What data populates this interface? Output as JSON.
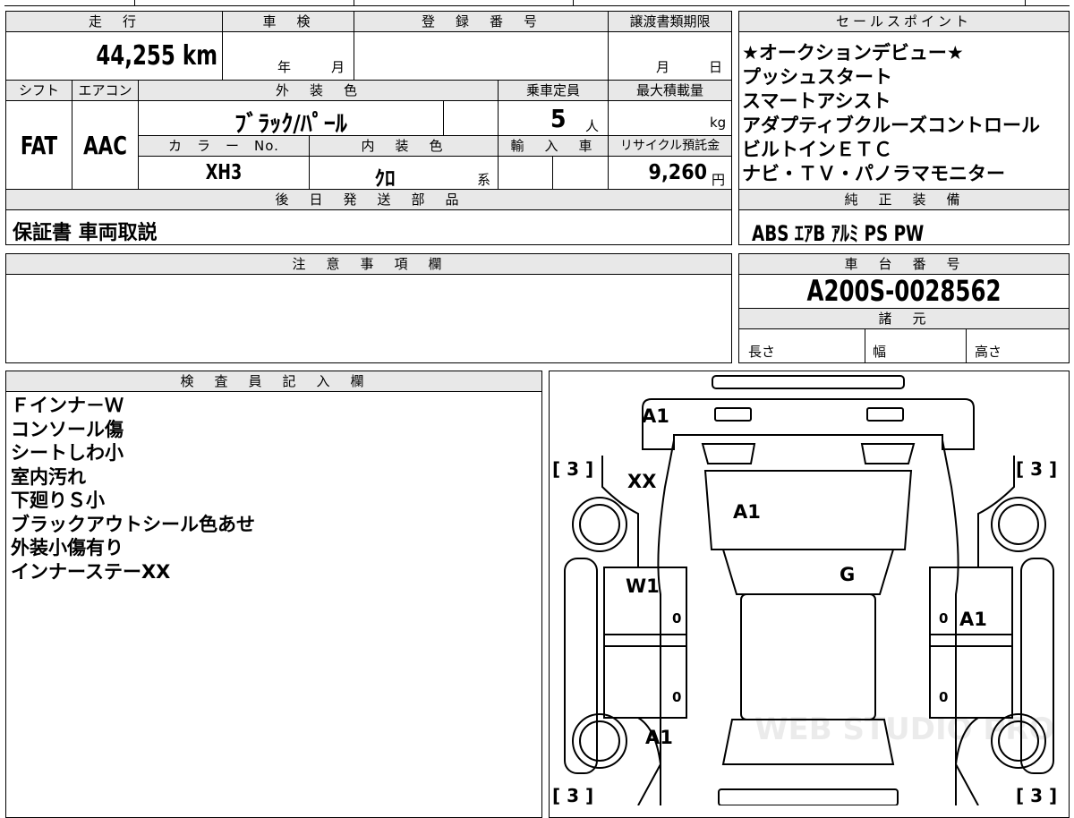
{
  "top_table": {
    "mileage_header": "走　行",
    "mileage_value": "44,255 km",
    "inspection_header": "車　検",
    "inspection_year_label": "年",
    "inspection_month_label": "月",
    "registration_header": "登　録　番　号",
    "transfer_deadline_header": "譲渡書類期限",
    "transfer_month_label": "月",
    "transfer_day_label": "日",
    "shift_header": "シフト",
    "shift_value": "FAT",
    "ac_header": "エアコン",
    "ac_value": "AAC",
    "exterior_color_header": "外　装　色",
    "exterior_color_value": "ﾌﾞﾗｯｸ/ﾊﾟｰﾙ",
    "capacity_header": "乗車定員",
    "capacity_value": "5",
    "capacity_unit": "人",
    "max_load_header": "最大積載量",
    "max_load_unit": "kg",
    "color_no_header": "カ　ラ　ー　No.",
    "color_no_value": "XH3",
    "interior_color_header": "内　装　色",
    "interior_color_value": "ｸﾛ",
    "interior_color_suffix": "系",
    "import_header": "輸　入　車",
    "recycle_header": "リサイクル預託金",
    "recycle_value": "9,260",
    "recycle_unit": "円"
  },
  "sales_points": {
    "header": "セールスポイント",
    "lines": [
      "★オークションデビュー★",
      "プッシュスタート",
      "スマートアシスト",
      "アダプティブクルーズコントロール",
      "ビルトインＥＴＣ",
      "ナビ・ＴＶ・パノラマモニター"
    ]
  },
  "later_parts": {
    "header": "後　日　発　送　部　品",
    "value": "保証書 車両取説"
  },
  "genuine_equipment": {
    "header": "純　正　装　備",
    "value": "ABS ｴｱB ｱﾙﾐ PS PW"
  },
  "notes": {
    "header": "注　意　事　項　欄"
  },
  "chassis": {
    "header": "車　台　番　号",
    "value": "A200S-0028562"
  },
  "specs": {
    "header": "諸　元",
    "length_label": "長さ",
    "width_label": "幅",
    "height_label": "高さ"
  },
  "inspector": {
    "header": "検　査　員　記　入　欄",
    "lines": [
      "Ｆインナ－Ｗ",
      "コンソール傷",
      "シートしわ小",
      "室内汚れ",
      "下廻りＳ小",
      "ブラックアウトシール色あせ",
      "外装小傷有り",
      "インナーステーXX"
    ]
  },
  "diagram": {
    "marks": {
      "front_top": "A1",
      "front_left_fender": "XX",
      "windshield": "A1",
      "left_front_door": "W1",
      "right_roof": "G",
      "right_front_door": "A1",
      "left_rear": "A1"
    },
    "tire_labels": {
      "front_left": "[ 3 ]",
      "front_right": "[ 3 ]",
      "rear_left": "[ 3 ]",
      "rear_right": "[ 3 ]"
    },
    "door_zero": "0",
    "watermark": "WEB STUDIO PRO"
  }
}
